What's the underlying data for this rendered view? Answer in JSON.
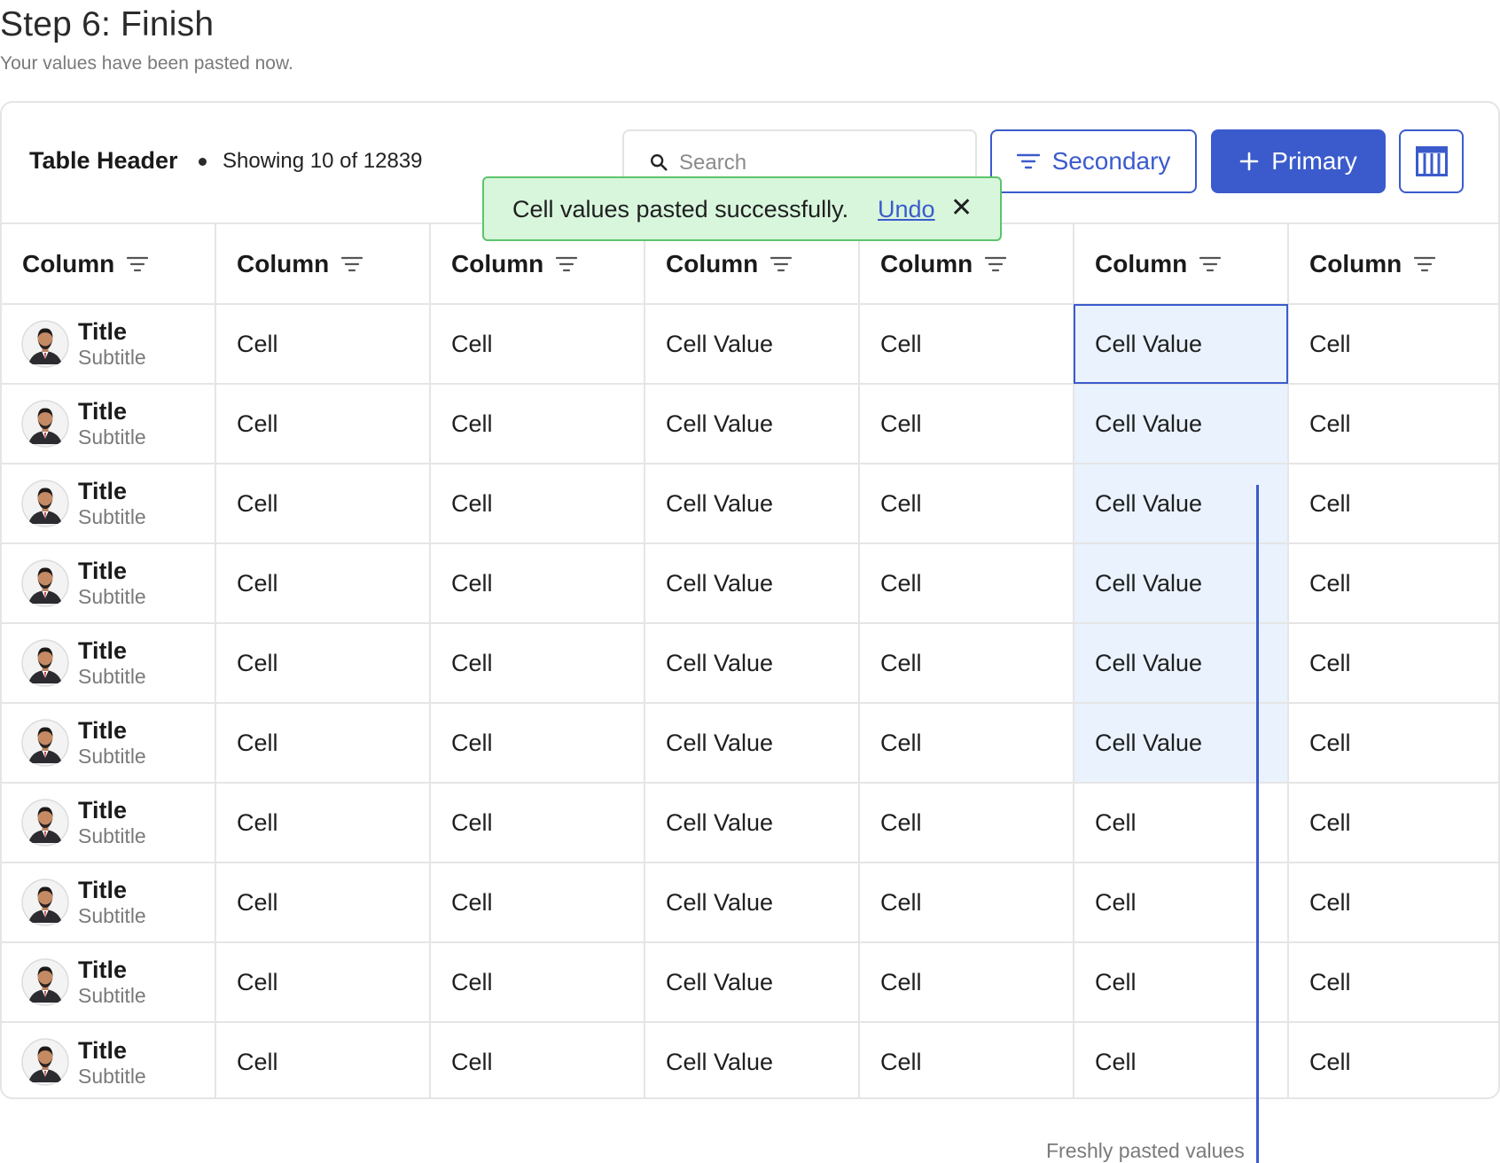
{
  "page": {
    "title": "Step 6: Finish",
    "subtitle": "Your values have been pasted now."
  },
  "toolbar": {
    "title": "Table Header",
    "count_text": "Showing 10 of 12839",
    "search_placeholder": "Search",
    "secondary_label": "Secondary",
    "primary_label": "Primary"
  },
  "toast": {
    "message": "Cell values pasted successfully.",
    "undo_label": "Undo",
    "close_symbol": "✕"
  },
  "columns": [
    "Column",
    "Column",
    "Column",
    "Column",
    "Column",
    "Column",
    "Column"
  ],
  "rows": [
    {
      "title": "Title",
      "subtitle": "Subtitle",
      "cells": [
        "Cell",
        "Cell",
        "Cell Value",
        "Cell",
        "Cell Value",
        "Cell"
      ],
      "pasted": true
    },
    {
      "title": "Title",
      "subtitle": "Subtitle",
      "cells": [
        "Cell",
        "Cell",
        "Cell Value",
        "Cell",
        "Cell Value",
        "Cell"
      ],
      "pasted": true
    },
    {
      "title": "Title",
      "subtitle": "Subtitle",
      "cells": [
        "Cell",
        "Cell",
        "Cell Value",
        "Cell",
        "Cell Value",
        "Cell"
      ],
      "pasted": true
    },
    {
      "title": "Title",
      "subtitle": "Subtitle",
      "cells": [
        "Cell",
        "Cell",
        "Cell Value",
        "Cell",
        "Cell Value",
        "Cell"
      ],
      "pasted": true
    },
    {
      "title": "Title",
      "subtitle": "Subtitle",
      "cells": [
        "Cell",
        "Cell",
        "Cell Value",
        "Cell",
        "Cell Value",
        "Cell"
      ],
      "pasted": true
    },
    {
      "title": "Title",
      "subtitle": "Subtitle",
      "cells": [
        "Cell",
        "Cell",
        "Cell Value",
        "Cell",
        "Cell Value",
        "Cell"
      ],
      "pasted": true
    },
    {
      "title": "Title",
      "subtitle": "Subtitle",
      "cells": [
        "Cell",
        "Cell",
        "Cell Value",
        "Cell",
        "Cell",
        "Cell"
      ],
      "pasted": false
    },
    {
      "title": "Title",
      "subtitle": "Subtitle",
      "cells": [
        "Cell",
        "Cell",
        "Cell Value",
        "Cell",
        "Cell",
        "Cell"
      ],
      "pasted": false
    },
    {
      "title": "Title",
      "subtitle": "Subtitle",
      "cells": [
        "Cell",
        "Cell",
        "Cell Value",
        "Cell",
        "Cell",
        "Cell"
      ],
      "pasted": false
    },
    {
      "title": "Title",
      "subtitle": "Subtitle",
      "cells": [
        "Cell",
        "Cell",
        "Cell Value",
        "Cell",
        "Cell",
        "Cell"
      ],
      "pasted": false
    }
  ],
  "pasted_column_index": 4,
  "annotation": {
    "label": "Freshly pasted values"
  },
  "colors": {
    "accent": "#3b5bcc",
    "pasted_bg": "#e9f2fd",
    "toast_bg": "#d8f6dc",
    "toast_border": "#5cc46c"
  },
  "icons": {
    "search": "search-icon",
    "filter": "filter-icon",
    "plus": "plus-icon",
    "columns": "columns-icon",
    "close": "close-icon"
  }
}
